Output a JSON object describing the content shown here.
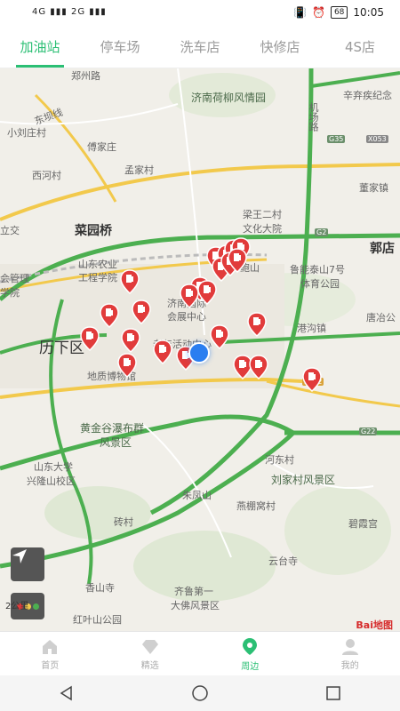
{
  "status_bar": {
    "signal_left": "4G ▮▮▮ 2G ▮▮▮",
    "battery": "68",
    "time": "10:05"
  },
  "tabs": [
    {
      "label": "加油站",
      "active": true
    },
    {
      "label": "停车场",
      "active": false
    },
    {
      "label": "洗车店",
      "active": false
    },
    {
      "label": "快修店",
      "active": false
    },
    {
      "label": "4S店",
      "active": false
    }
  ],
  "map": {
    "labels": {
      "l1": "郑州路",
      "l2": "济南荷柳风情园",
      "l3": "东坝线",
      "l4": "小刘庄村",
      "l5": "傅家庄",
      "l6": "孟家村",
      "l7": "西河村",
      "l8": "董家镇",
      "l9": "梁王二村",
      "l10": "文化大院",
      "l11": "菜园桥",
      "l12": "立交",
      "l13": "郭店",
      "l14": "山东农业",
      "l15": "工程学院",
      "l16": "会管理",
      "l17": "学院",
      "l18": "鲍山",
      "l19": "鲁能泰山7号",
      "l20": "体育公园",
      "l21": "济南国际",
      "l22": "会展中心",
      "l23": "港沟镇",
      "l24": "唐冶公",
      "l25": "历下区",
      "l26": "老年活动中心",
      "l27": "地质博物馆",
      "l28": "黄金谷瀑布群",
      "l29": "风景区",
      "l30": "山东大学",
      "l31": "兴隆山校区",
      "l32": "河东村",
      "l33": "刘家村风景区",
      "l34": "朱凤山",
      "l35": "燕棚窝村",
      "l36": "碧霞宫",
      "l37": "砖村",
      "l38": "云台寺",
      "l39": "香山寺",
      "l40": "齐鲁第一",
      "l41": "大佛风景区",
      "l42": "红叶山公园",
      "l43": "辛弃疾纪念",
      "l44": "机场路"
    },
    "road_shields": {
      "r1": "G35",
      "r2": "X053",
      "r3": "G2",
      "r4": "G22",
      "r5": "S102"
    },
    "scale": "2公里",
    "provider_logo": "Bai地图"
  },
  "bottom_nav": [
    {
      "label": "首页",
      "icon": "home-icon",
      "active": false
    },
    {
      "label": "精选",
      "icon": "diamond-icon",
      "active": false
    },
    {
      "label": "周边",
      "icon": "location-icon",
      "active": true
    },
    {
      "label": "我的",
      "icon": "user-icon",
      "active": false
    }
  ],
  "colors": {
    "accent": "#2bbf74",
    "pin": "#e13b3b",
    "highway": "#4caf50",
    "arterial": "#f2c94c"
  }
}
